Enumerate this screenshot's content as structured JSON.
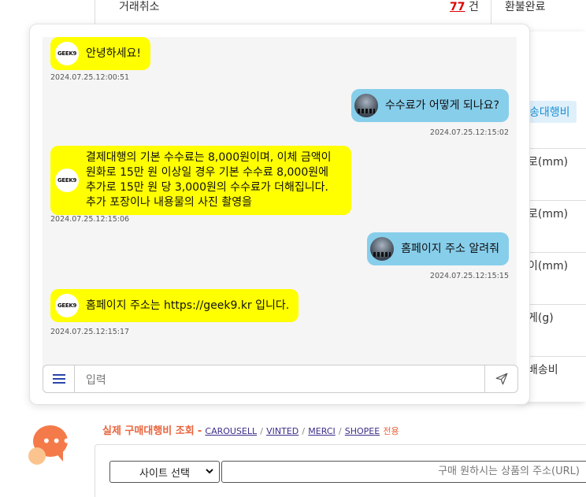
{
  "background": {
    "top_row": {
      "cancel_label": "거래취소",
      "count_value": "77",
      "count_unit": "건",
      "refund_label": "환불완료"
    },
    "right_panel": {
      "tab_label": "송대행비",
      "rows": [
        "로(mm)",
        "로(mm)",
        "이(mm)",
        "게(g)",
        "배송비"
      ]
    },
    "calc": {
      "title": "실제 구매대행비 조회",
      "dash": "-",
      "links": [
        "CAROUSELL",
        "VINTED",
        "MERCI",
        "SHOPEE"
      ],
      "separator": "/",
      "suffix": "전용",
      "site_select_value": "사이트 선택",
      "url_placeholder": "구매 원하시는 상품의 주소(URL)"
    }
  },
  "chat": {
    "bot_avatar_label": "GEEK9",
    "messages": [
      {
        "from": "bot",
        "text": "안녕하세요!",
        "time": "2024.07.25.12:00:51"
      },
      {
        "from": "user",
        "text": "수수료가 어떻게 되나요?",
        "time": "2024.07.25.12:15:02"
      },
      {
        "from": "bot",
        "text": "결제대행의 기본 수수료는 8,000원이며, 이체 금액이 원화로 15만 원 이상일 경우 기본 수수료 8,000원에 추가로 15만 원 당 3,000원의 수수료가 더해집니다. 추가 포장이나 내용물의 사진 촬영을",
        "time": "2024.07.25.12:15:06"
      },
      {
        "from": "user",
        "text": "홈페이지 주소 알려줘",
        "time": "2024.07.25.12:15:15"
      },
      {
        "from": "bot",
        "text": "홈페이지 주소는 https://geek9.kr 입니다.",
        "time": "2024.07.25.12:15:17"
      }
    ],
    "input_placeholder": "입력"
  },
  "colors": {
    "bot_bubble": "#ffff00",
    "user_bubble": "#87ceeb",
    "accent": "#2946a8",
    "fab": "#f47a4a"
  }
}
